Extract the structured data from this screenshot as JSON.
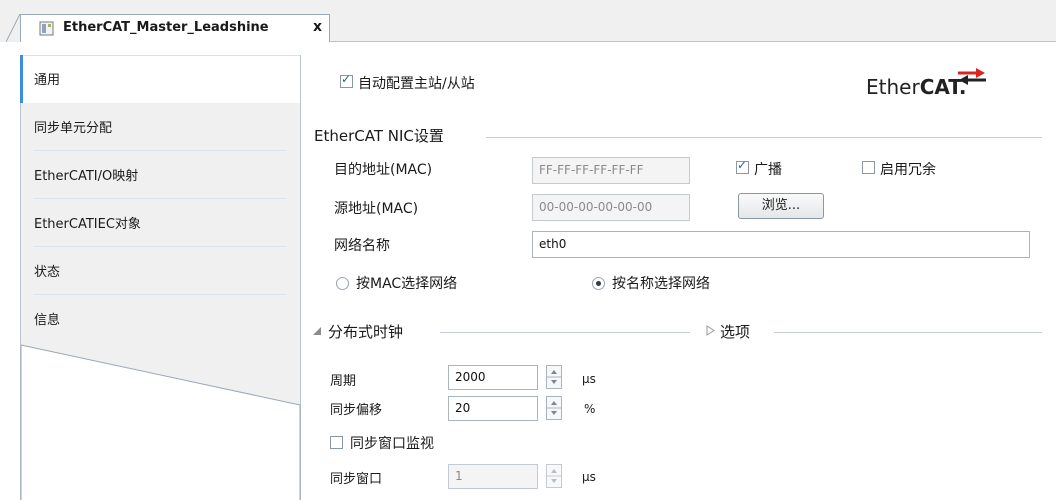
{
  "tab": {
    "title": "EtherCAT_Master_Leadshine",
    "close": "x"
  },
  "nav": {
    "items": [
      {
        "label": "通用"
      },
      {
        "label": "同步单元分配"
      },
      {
        "label": "EtherCATI/O映射"
      },
      {
        "label": "EtherCATIEC对象"
      },
      {
        "label": "状态"
      },
      {
        "label": "信息"
      }
    ]
  },
  "content": {
    "auto_config_label": "自动配置主站/从站",
    "auto_config_checked": true,
    "logo": {
      "ether": "Ether",
      "cat": "CAT."
    },
    "nic": {
      "section_title": "EtherCAT NIC设置",
      "dest_label": "目的地址(MAC)",
      "dest_value": "FF-FF-FF-FF-FF-FF",
      "broadcast_label": "广播",
      "broadcast_checked": true,
      "redundancy_label": "启用冗余",
      "redundancy_checked": false,
      "src_label": "源地址(MAC)",
      "src_value": "00-00-00-00-00-00",
      "browse_label": "浏览...",
      "network_name_label": "网络名称",
      "network_name_value": "eth0",
      "radio_mac_label": "按MAC选择网络",
      "radio_name_label": "按名称选择网络",
      "selected_radio": "name"
    },
    "dc": {
      "section_title": "分布式时钟",
      "options_title": "选项",
      "cycle_label": "周期",
      "cycle_value": "2000",
      "cycle_unit": "μs",
      "offset_label": "同步偏移",
      "offset_value": "20",
      "offset_unit": "%",
      "sync_window_monitor_label": "同步窗口监视",
      "sync_window_monitor_checked": false,
      "sync_window_label": "同步窗口",
      "sync_window_value": "1",
      "sync_window_unit": "μs"
    }
  },
  "colors": {
    "nav_accent": "#3b8de0",
    "panel_bg": "#f0f0f0",
    "tab_border": "#9aa8b8"
  }
}
